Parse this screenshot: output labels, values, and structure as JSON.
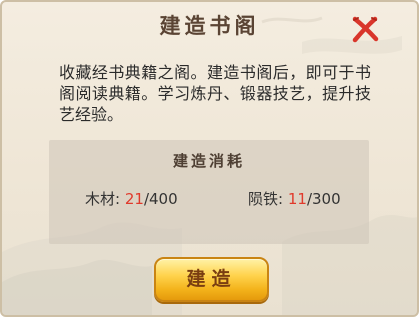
{
  "dialog": {
    "title": "建造书阁",
    "description": "收藏经书典籍之阁。建造书阁后，即可于书阁阅读典籍。学习炼丹、锻器技艺，提升技艺经验。",
    "close_icon": "close-x-icon"
  },
  "cost": {
    "title": "建造消耗",
    "items": [
      {
        "name_label": "木材:",
        "current": "21",
        "required": "/400"
      },
      {
        "name_label": "陨铁:",
        "current": "11",
        "required": "/300"
      }
    ]
  },
  "actions": {
    "build_label": "建造"
  },
  "colors": {
    "insufficient": "#e0392b",
    "accent_gold": "#f3b21a",
    "close_red": "#d9362b"
  }
}
